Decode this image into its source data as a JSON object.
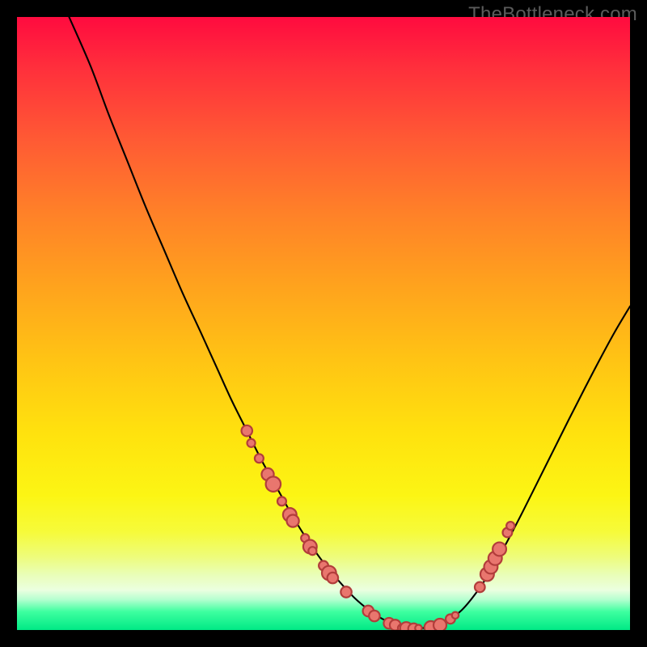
{
  "watermark": "TheBottleneck.com",
  "colors": {
    "background": "#000000",
    "gradient_top": "#ff0b3f",
    "gradient_bottom": "#00e985",
    "curve": "#000000",
    "marker_fill": "#e9766e",
    "marker_stroke": "#b23d3b"
  },
  "chart_data": {
    "type": "line",
    "title": "",
    "xlabel": "",
    "ylabel": "",
    "xlim": [
      0,
      100
    ],
    "ylim": [
      0,
      100
    ],
    "series": [
      {
        "name": "curve",
        "x": [
          8.5,
          12,
          15,
          18,
          21,
          24,
          27,
          30,
          32.5,
          35,
          37.5,
          40,
          42.5,
          45,
          47.5,
          50,
          52.5,
          55,
          57.5,
          60,
          62.5,
          65,
          67.5,
          70,
          72.5,
          75,
          77.5,
          80,
          82.5,
          85,
          87.5,
          90,
          92.5,
          95,
          97.5,
          100
        ],
        "y": [
          100,
          92,
          84,
          76.5,
          69,
          62,
          55,
          48.5,
          43,
          37.5,
          32.5,
          27.5,
          23,
          18.5,
          14.5,
          11,
          8,
          5.3,
          3.2,
          1.6,
          0.7,
          0.3,
          0.5,
          1.4,
          3.2,
          6.2,
          10,
          14.5,
          19.3,
          24.3,
          29.3,
          34.3,
          39.2,
          44,
          48.6,
          52.8
        ]
      }
    ],
    "markers": {
      "name": "highlight-points",
      "points": [
        {
          "x": 37.5,
          "y": 32.5,
          "r": 1.6
        },
        {
          "x": 38.2,
          "y": 30.5,
          "r": 1.2
        },
        {
          "x": 39.5,
          "y": 28.0,
          "r": 1.3
        },
        {
          "x": 40.9,
          "y": 25.4,
          "r": 1.8
        },
        {
          "x": 41.8,
          "y": 23.8,
          "r": 2.2
        },
        {
          "x": 43.2,
          "y": 21.0,
          "r": 1.3
        },
        {
          "x": 44.5,
          "y": 18.8,
          "r": 2.0
        },
        {
          "x": 45.0,
          "y": 17.8,
          "r": 1.8
        },
        {
          "x": 47.0,
          "y": 15.0,
          "r": 1.2
        },
        {
          "x": 47.8,
          "y": 13.6,
          "r": 2.0
        },
        {
          "x": 48.2,
          "y": 12.9,
          "r": 1.2
        },
        {
          "x": 50.0,
          "y": 10.5,
          "r": 1.4
        },
        {
          "x": 50.9,
          "y": 9.3,
          "r": 2.1
        },
        {
          "x": 51.5,
          "y": 8.5,
          "r": 1.6
        },
        {
          "x": 53.7,
          "y": 6.2,
          "r": 1.6
        },
        {
          "x": 57.3,
          "y": 3.1,
          "r": 1.6
        },
        {
          "x": 58.3,
          "y": 2.3,
          "r": 1.6
        },
        {
          "x": 60.7,
          "y": 1.1,
          "r": 1.6
        },
        {
          "x": 61.7,
          "y": 0.8,
          "r": 1.6
        },
        {
          "x": 62.8,
          "y": 0.3,
          "r": 1.2
        },
        {
          "x": 63.5,
          "y": 0.3,
          "r": 1.8
        },
        {
          "x": 64.7,
          "y": 0.2,
          "r": 1.6
        },
        {
          "x": 65.5,
          "y": 0.3,
          "r": 1.0
        },
        {
          "x": 67.5,
          "y": 0.4,
          "r": 1.9
        },
        {
          "x": 69.0,
          "y": 0.8,
          "r": 1.9
        },
        {
          "x": 70.7,
          "y": 1.8,
          "r": 1.4
        },
        {
          "x": 71.5,
          "y": 2.4,
          "r": 1.0
        },
        {
          "x": 75.5,
          "y": 7.0,
          "r": 1.5
        },
        {
          "x": 76.7,
          "y": 9.1,
          "r": 2.0
        },
        {
          "x": 77.3,
          "y": 10.3,
          "r": 2.0
        },
        {
          "x": 78.0,
          "y": 11.7,
          "r": 2.0
        },
        {
          "x": 78.7,
          "y": 13.2,
          "r": 2.0
        },
        {
          "x": 80.0,
          "y": 15.9,
          "r": 1.4
        },
        {
          "x": 80.5,
          "y": 17.0,
          "r": 1.2
        }
      ]
    }
  }
}
